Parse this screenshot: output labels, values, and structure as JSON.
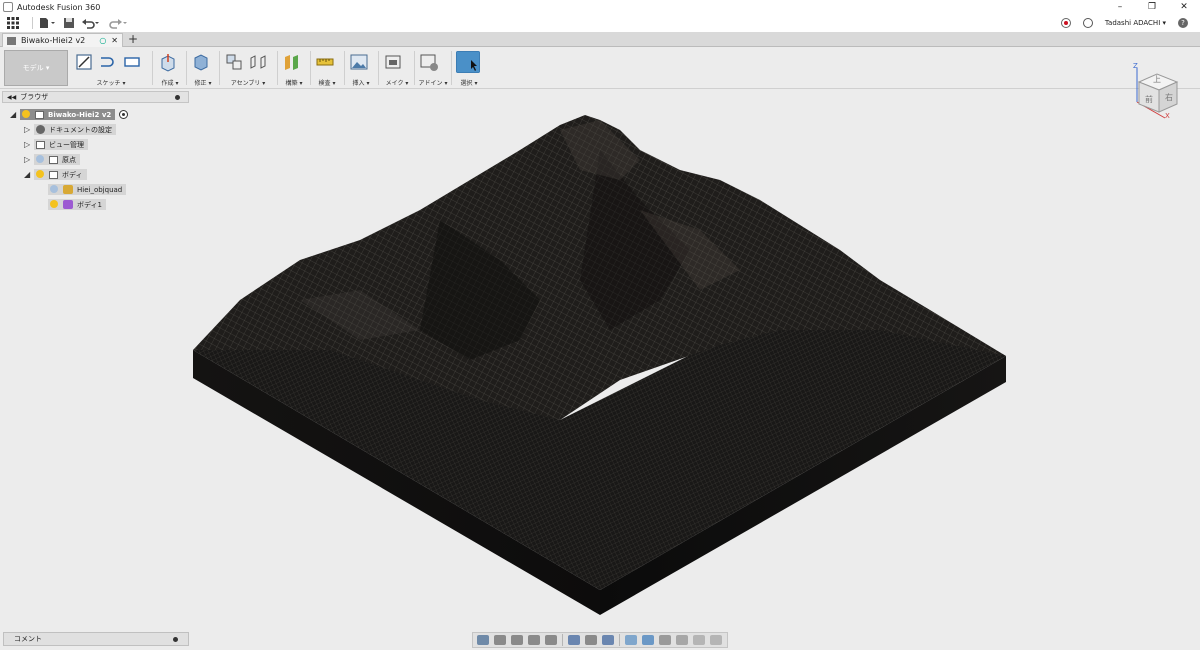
{
  "app": {
    "title": "Autodesk Fusion 360"
  },
  "window_controls": {
    "minimize": "–",
    "restore": "❐",
    "close": "✕"
  },
  "qat": {
    "user": "Tadashi ADACHI ▾",
    "help": "?"
  },
  "document_tab": {
    "name": "Biwako-Hiei2 v2",
    "add": "+"
  },
  "toolbar": {
    "workspace": "モデル ▾",
    "groups": [
      {
        "label": "スケッチ ▾"
      },
      {
        "label": "作成 ▾"
      },
      {
        "label": "修正 ▾"
      },
      {
        "label": "アセンブリ ▾"
      },
      {
        "label": "構築 ▾"
      },
      {
        "label": "検査 ▾"
      },
      {
        "label": "挿入 ▾"
      },
      {
        "label": "メイク ▾"
      },
      {
        "label": "アドイン ▾"
      },
      {
        "label": "選択 ▾"
      }
    ]
  },
  "browser": {
    "title": "ブラウザ",
    "root": "Biwako-Hiei2 v2",
    "items": [
      {
        "label": "ドキュメントの設定"
      },
      {
        "label": "ビュー管理"
      },
      {
        "label": "原点"
      },
      {
        "label": "ボディ"
      },
      {
        "label": "Hiei_objquad"
      },
      {
        "label": "ボディ1"
      }
    ]
  },
  "viewcube": {
    "top": "上",
    "front": "前",
    "right": "右",
    "axis_z": "Z",
    "axis_x": "X"
  },
  "comments": {
    "label": "コメント"
  },
  "colors": {
    "accent": "#4a90c8",
    "terrain": "#1c1a18",
    "background": "#ececec"
  }
}
